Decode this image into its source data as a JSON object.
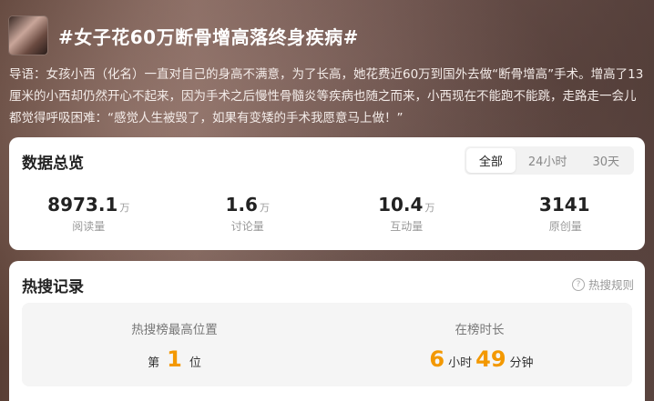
{
  "topic": {
    "title": "#女子花60万断骨增高落终身疾病#",
    "intro": "导语：女孩小西（化名）一直对自己的身高不满意，为了长高，她花费近60万到国外去做“断骨增高”手术。增高了13厘米的小西却仍然开心不起来，因为手术之后慢性骨髓炎等疾病也随之而来，小西现在不能跑不能跳，走路走一会儿都觉得呼吸困难：“感觉人生被毁了，如果有变矮的手术我愿意马上做！”"
  },
  "overview": {
    "title": "数据总览",
    "tabs": [
      "全部",
      "24小时",
      "30天"
    ],
    "active_tab": "全部",
    "stats": [
      {
        "value": "8973.1",
        "unit": "万",
        "label": "阅读量"
      },
      {
        "value": "1.6",
        "unit": "万",
        "label": "讨论量"
      },
      {
        "value": "10.4",
        "unit": "万",
        "label": "互动量"
      },
      {
        "value": "3141",
        "unit": "",
        "label": "原创量"
      }
    ]
  },
  "hot_search": {
    "title": "热搜记录",
    "rules_label": "热搜规则",
    "help_glyph": "?",
    "peak": {
      "label": "热搜榜最高位置",
      "prefix": "第",
      "value": "1",
      "suffix": "位"
    },
    "duration": {
      "label": "在榜时长",
      "hours": "6",
      "hours_unit": "小时",
      "minutes": "49",
      "minutes_unit": "分钟"
    }
  },
  "colors": {
    "accent": "#f39800",
    "card_bg": "#ffffff",
    "panel_bg": "#f5f5f5"
  }
}
